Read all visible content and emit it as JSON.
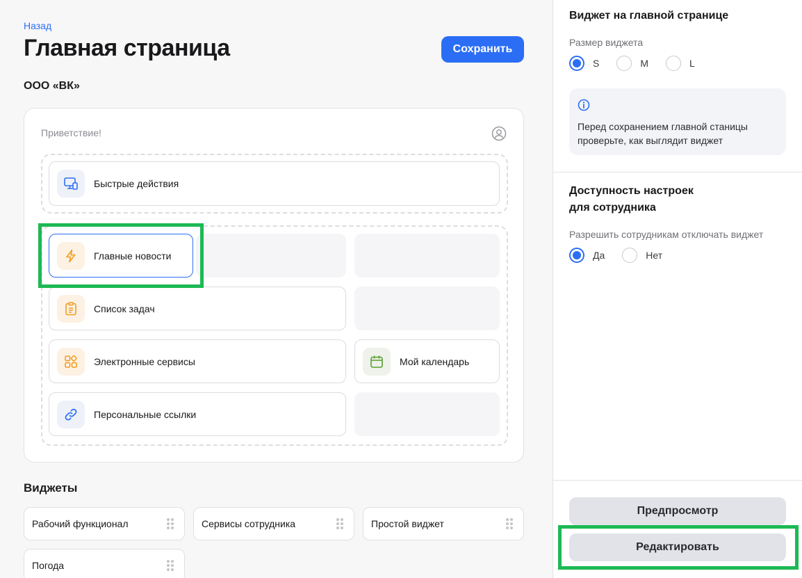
{
  "header": {
    "back_label": "Назад",
    "title": "Главная страница",
    "save_label": "Сохранить",
    "org_name": "ООО «ВК»"
  },
  "preview": {
    "greeting": "Приветствие!",
    "top_widget": {
      "label": "Быстрые действия",
      "icon": "monitor-icon"
    },
    "tiles": [
      {
        "label": "Главные новости",
        "icon": "lightning-icon",
        "selected": true
      },
      {
        "label": "Список задач",
        "icon": "clipboard-icon"
      },
      {
        "label": "Электронные сервисы",
        "icon": "apps-grid-icon"
      },
      {
        "label": "Мой календарь",
        "icon": "calendar-icon"
      },
      {
        "label": "Персональные ссылки",
        "icon": "link-icon"
      }
    ]
  },
  "widgets": {
    "title": "Виджеты",
    "items": [
      {
        "label": "Рабочий функционал"
      },
      {
        "label": "Сервисы сотрудника"
      },
      {
        "label": "Простой виджет"
      },
      {
        "label": "Погода"
      }
    ]
  },
  "side": {
    "widget_section_title": "Виджет на главной странице",
    "size_label": "Размер виджета",
    "size_options": [
      {
        "label": "S",
        "checked": true
      },
      {
        "label": "M",
        "checked": false
      },
      {
        "label": "L",
        "checked": false
      }
    ],
    "info_text": "Перед сохранением главной станицы проверьте, как выглядит виджет",
    "access_title_line1": "Доступность настроек",
    "access_title_line2": "для сотрудника",
    "allow_label": "Разрешить сотрудникам отключать виджет",
    "allow_options": [
      {
        "label": "Да",
        "checked": true
      },
      {
        "label": "Нет",
        "checked": false
      }
    ],
    "preview_label": "Предпросмотр",
    "edit_label": "Редактировать"
  },
  "colors": {
    "accent": "#2b6ef5",
    "highlight": "#1db954",
    "orange_icon": "#f29b1f",
    "green_icon": "#5a9e2f"
  }
}
